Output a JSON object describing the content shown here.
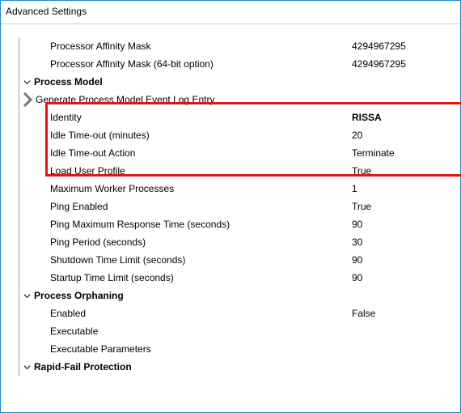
{
  "window": {
    "title": "Advanced Settings"
  },
  "rows": {
    "procAffinityMask": {
      "label": "Processor Affinity Mask",
      "value": "4294967295"
    },
    "procAffinityMask64": {
      "label": "Processor Affinity Mask (64-bit option)",
      "value": "4294967295"
    },
    "processModel": {
      "label": "Process Model"
    },
    "genProcModelEvt": {
      "label": "Generate Process Model Event Log Entry"
    },
    "identity": {
      "label": "Identity",
      "value": "RISSA"
    },
    "idleTimeout": {
      "label": "Idle Time-out (minutes)",
      "value": "20"
    },
    "idleTimeoutAction": {
      "label": "Idle Time-out Action",
      "value": "Terminate"
    },
    "loadUserProfile": {
      "label": "Load User Profile",
      "value": "True"
    },
    "maxWorker": {
      "label": "Maximum Worker Processes",
      "value": "1"
    },
    "pingEnabled": {
      "label": "Ping Enabled",
      "value": "True"
    },
    "pingMaxResp": {
      "label": "Ping Maximum Response Time (seconds)",
      "value": "90"
    },
    "pingPeriod": {
      "label": "Ping Period (seconds)",
      "value": "30"
    },
    "shutdownTime": {
      "label": "Shutdown Time Limit (seconds)",
      "value": "90"
    },
    "startupTime": {
      "label": "Startup Time Limit (seconds)",
      "value": "90"
    },
    "processOrphaning": {
      "label": "Process Orphaning"
    },
    "orphEnabled": {
      "label": "Enabled",
      "value": "False"
    },
    "orphExecutable": {
      "label": "Executable",
      "value": ""
    },
    "orphExecParams": {
      "label": "Executable Parameters",
      "value": ""
    },
    "rapidFail": {
      "label": "Rapid-Fail Protection"
    }
  }
}
